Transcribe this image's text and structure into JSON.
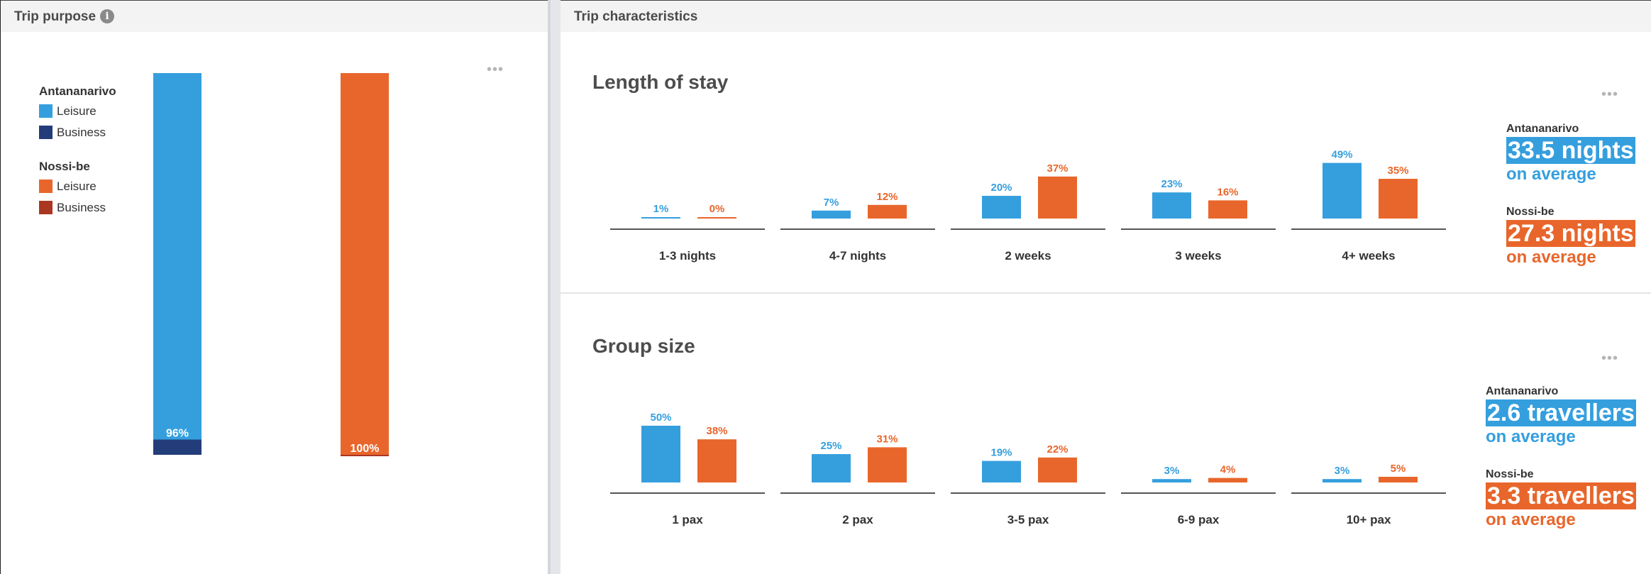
{
  "colors": {
    "antananarivo_leisure": "#359fde",
    "antananarivo_business": "#233d7a",
    "nossibe_leisure": "#e8662b",
    "nossibe_business": "#a93722",
    "axis": "#555555"
  },
  "left_panel": {
    "title": "Trip purpose",
    "info_icon": "info-icon",
    "menu_icon": "more-dots-icon",
    "legend": {
      "groups": [
        {
          "title": "Antananarivo",
          "items": [
            {
              "label": "Leisure"
            },
            {
              "label": "Business"
            }
          ]
        },
        {
          "title": "Nossi-be",
          "items": [
            {
              "label": "Leisure"
            },
            {
              "label": "Business"
            }
          ]
        }
      ]
    }
  },
  "right_panel": {
    "title": "Trip characteristics",
    "length_of_stay": {
      "title": "Length of stay",
      "menu_icon": "more-dots-icon",
      "averages": [
        {
          "city": "Antananarivo",
          "value": "33.5 nights",
          "suffix": "on average"
        },
        {
          "city": "Nossi-be",
          "value": "27.3 nights",
          "suffix": "on average"
        }
      ]
    },
    "group_size": {
      "title": "Group size",
      "menu_icon": "more-dots-icon",
      "averages": [
        {
          "city": "Antananarivo",
          "value": "2.6 travellers",
          "suffix": "on average"
        },
        {
          "city": "Nossi-be",
          "value": "3.3 travellers",
          "suffix": "on average"
        }
      ]
    }
  },
  "chart_data": [
    {
      "id": "trip_purpose",
      "type": "bar",
      "stacked": true,
      "categories": [
        "Antananarivo",
        "Nossi-be"
      ],
      "series": [
        {
          "name": "Leisure",
          "values": [
            96,
            100
          ],
          "labels": [
            "96%",
            "100%"
          ]
        },
        {
          "name": "Business",
          "values": [
            4,
            0
          ]
        }
      ],
      "ylim": [
        0,
        100
      ],
      "grid": false,
      "legend": "left"
    },
    {
      "id": "length_of_stay",
      "type": "bar",
      "title": "Length of stay",
      "categories": [
        "1-3 nights",
        "4-7 nights",
        "2 weeks",
        "3 weeks",
        "4+ weeks"
      ],
      "series": [
        {
          "name": "Antananarivo",
          "values": [
            1,
            7,
            20,
            23,
            49
          ],
          "labels": [
            "1%",
            "7%",
            "20%",
            "23%",
            "49%"
          ]
        },
        {
          "name": "Nossi-be",
          "values": [
            0,
            12,
            37,
            16,
            35
          ],
          "labels": [
            "0%",
            "12%",
            "37%",
            "16%",
            "35%"
          ]
        }
      ],
      "ylim": [
        0,
        50
      ],
      "grid": false
    },
    {
      "id": "group_size",
      "type": "bar",
      "title": "Group size",
      "categories": [
        "1 pax",
        "2 pax",
        "3-5 pax",
        "6-9 pax",
        "10+ pax"
      ],
      "series": [
        {
          "name": "Antananarivo",
          "values": [
            50,
            25,
            19,
            3,
            3
          ],
          "labels": [
            "50%",
            "25%",
            "19%",
            "3%",
            "3%"
          ]
        },
        {
          "name": "Nossi-be",
          "values": [
            38,
            31,
            22,
            4,
            5
          ],
          "labels": [
            "38%",
            "31%",
            "22%",
            "4%",
            "5%"
          ]
        }
      ],
      "ylim": [
        0,
        50
      ],
      "grid": false
    }
  ]
}
